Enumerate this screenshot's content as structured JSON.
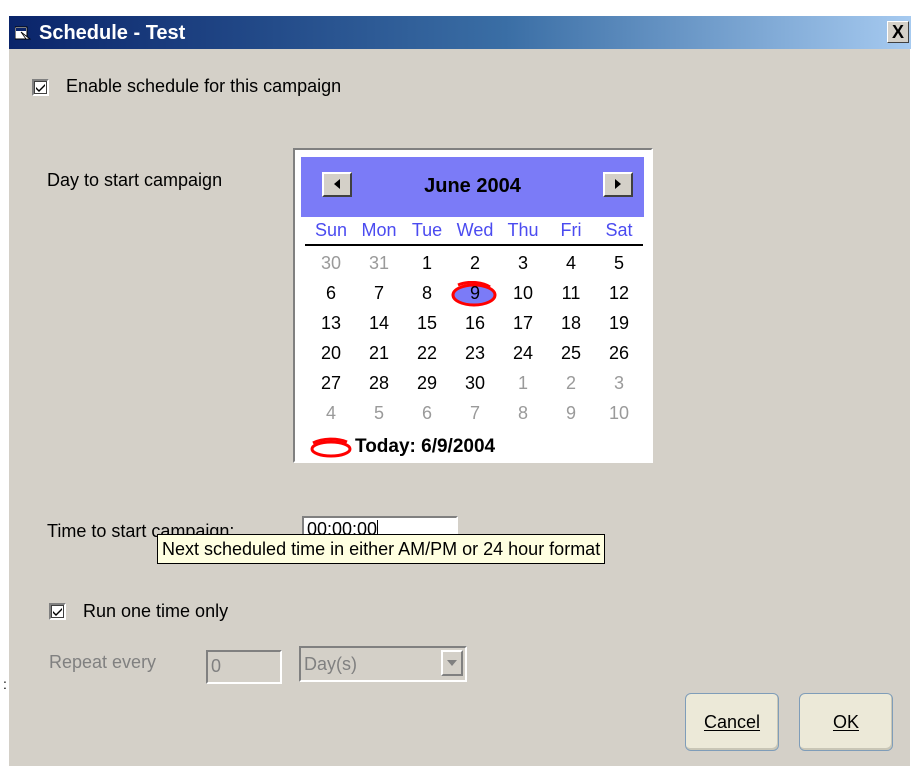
{
  "window": {
    "title": "Schedule - Test",
    "close_label": "X"
  },
  "enable_schedule": {
    "label": "Enable schedule for this campaign",
    "checked": true
  },
  "day_to_start": {
    "label": "Day to start campaign"
  },
  "calendar": {
    "month_label": "June 2004",
    "weekdays": [
      "Sun",
      "Mon",
      "Tue",
      "Wed",
      "Thu",
      "Fri",
      "Sat"
    ],
    "weeks": [
      [
        "30",
        "31",
        "1",
        "2",
        "3",
        "4",
        "5"
      ],
      [
        "6",
        "7",
        "8",
        "9",
        "10",
        "11",
        "12"
      ],
      [
        "13",
        "14",
        "15",
        "16",
        "17",
        "18",
        "19"
      ],
      [
        "20",
        "21",
        "22",
        "23",
        "24",
        "25",
        "26"
      ],
      [
        "27",
        "28",
        "29",
        "30",
        "1",
        "2",
        "3"
      ],
      [
        "4",
        "5",
        "6",
        "7",
        "8",
        "9",
        "10"
      ]
    ],
    "selected_day": "9",
    "today_label": "Today: 6/9/2004",
    "header_color": "#7b7bf7",
    "weekday_color": "#4b4bf0",
    "highlight_color": "#ff0000"
  },
  "time_to_start": {
    "label": "Time to start campaign:",
    "value": "00:00:00"
  },
  "tooltip": {
    "text": "Next scheduled time in either AM/PM or 24 hour format"
  },
  "run_once": {
    "label": "Run one time only",
    "checked": true
  },
  "repeat": {
    "label": "Repeat every",
    "value": "0",
    "unit": "Day(s)"
  },
  "buttons": {
    "cancel": "Cancel",
    "ok": "OK"
  },
  "side_marker": ":"
}
